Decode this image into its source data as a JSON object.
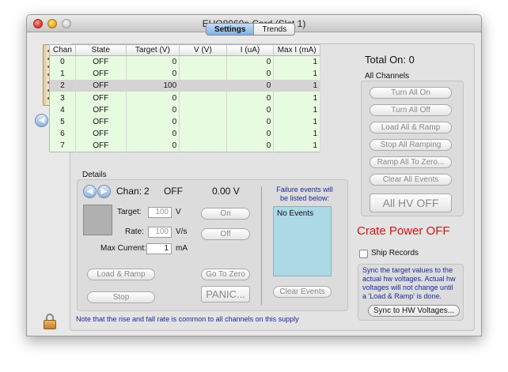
{
  "window": {
    "title": "EHQ8060n Card (Slot 1)"
  },
  "tabs": [
    {
      "label": "Settings",
      "selected": true
    },
    {
      "label": "Trends",
      "selected": false
    }
  ],
  "table": {
    "headers": [
      "Chan",
      "State",
      "Target (V)",
      "V (V)",
      "I (uA)",
      "Max I (mA)"
    ],
    "rows": [
      [
        "0",
        "OFF",
        "0",
        "",
        "0",
        "1"
      ],
      [
        "1",
        "OFF",
        "0",
        "",
        "0",
        "1"
      ],
      [
        "2",
        "OFF",
        "100",
        "",
        "0",
        "1"
      ],
      [
        "3",
        "OFF",
        "0",
        "",
        "0",
        "1"
      ],
      [
        "4",
        "OFF",
        "0",
        "",
        "0",
        "1"
      ],
      [
        "5",
        "OFF",
        "0",
        "",
        "0",
        "1"
      ],
      [
        "6",
        "OFF",
        "0",
        "",
        "0",
        "1"
      ],
      [
        "7",
        "OFF",
        "0",
        "",
        "0",
        "1"
      ]
    ],
    "selected_row": 2
  },
  "right": {
    "total_on": "Total On: 0",
    "all_channels": "All Channels",
    "buttons": [
      "Turn All On",
      "Turn All Off",
      "Load All & Ramp",
      "Stop All Ramping",
      "Ramp All To Zero...",
      "Clear All Events"
    ],
    "all_hv_off": "All HV OFF",
    "crate_power": "Crate Power OFF",
    "ship_records": "Ship Records",
    "sync_note": "Sync the target values to the actual hw voltages. Actual hw voltages will not change until a 'Load & Ramp' is done.",
    "sync_button": "Sync to HW Voltages..."
  },
  "details": {
    "label": "Details",
    "chan_label": "Chan:",
    "chan_value": "2",
    "state": "OFF",
    "voltage": "0.00 V",
    "target_label": "Target:",
    "target_value": "100",
    "target_unit": "V",
    "rate_label": "Rate:",
    "rate_value": "100",
    "rate_unit": "V/s",
    "maxcur_label": "Max Current:",
    "maxcur_value": "1",
    "maxcur_unit": "mA",
    "on_button": "On",
    "off_button": "Off",
    "load_ramp_button": "Load & Ramp",
    "go_to_zero_button": "Go To Zero",
    "stop_button": "Stop",
    "panic_button": "PANIC...",
    "failure_text": "Failure events will be listed below:",
    "events_item": "No Events",
    "clear_events_button": "Clear Events"
  },
  "footer_note": "Note that the rise and fall rate is common to all channels on this supply",
  "colors": {
    "row_green": "#e7fbe0",
    "selected_row": "#d4d4d4",
    "crate_red": "#d31414",
    "note_blue": "#1a2a9a",
    "events_box": "#add8e6"
  }
}
